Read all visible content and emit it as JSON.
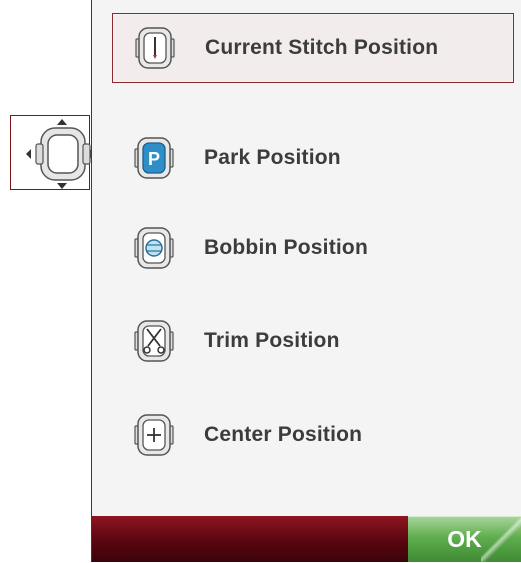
{
  "move_button": {
    "icon": "hoop-move-arrows-icon"
  },
  "menu": {
    "items": [
      {
        "label": "Current Stitch Position",
        "icon": "needle-hoop-icon",
        "selected": true
      },
      {
        "label": "Park Position",
        "icon": "park-p-icon",
        "selected": false
      },
      {
        "label": "Bobbin Position",
        "icon": "bobbin-icon",
        "selected": false
      },
      {
        "label": "Trim Position",
        "icon": "scissors-icon",
        "selected": false
      },
      {
        "label": "Center Position",
        "icon": "center-plus-icon",
        "selected": false
      }
    ]
  },
  "footer": {
    "ok_label": "OK"
  },
  "colors": {
    "accent_red": "#8a2a2d",
    "bar_red": "#5a0610",
    "ok_green": "#5fae4e",
    "park_blue": "#2e8fc8"
  }
}
